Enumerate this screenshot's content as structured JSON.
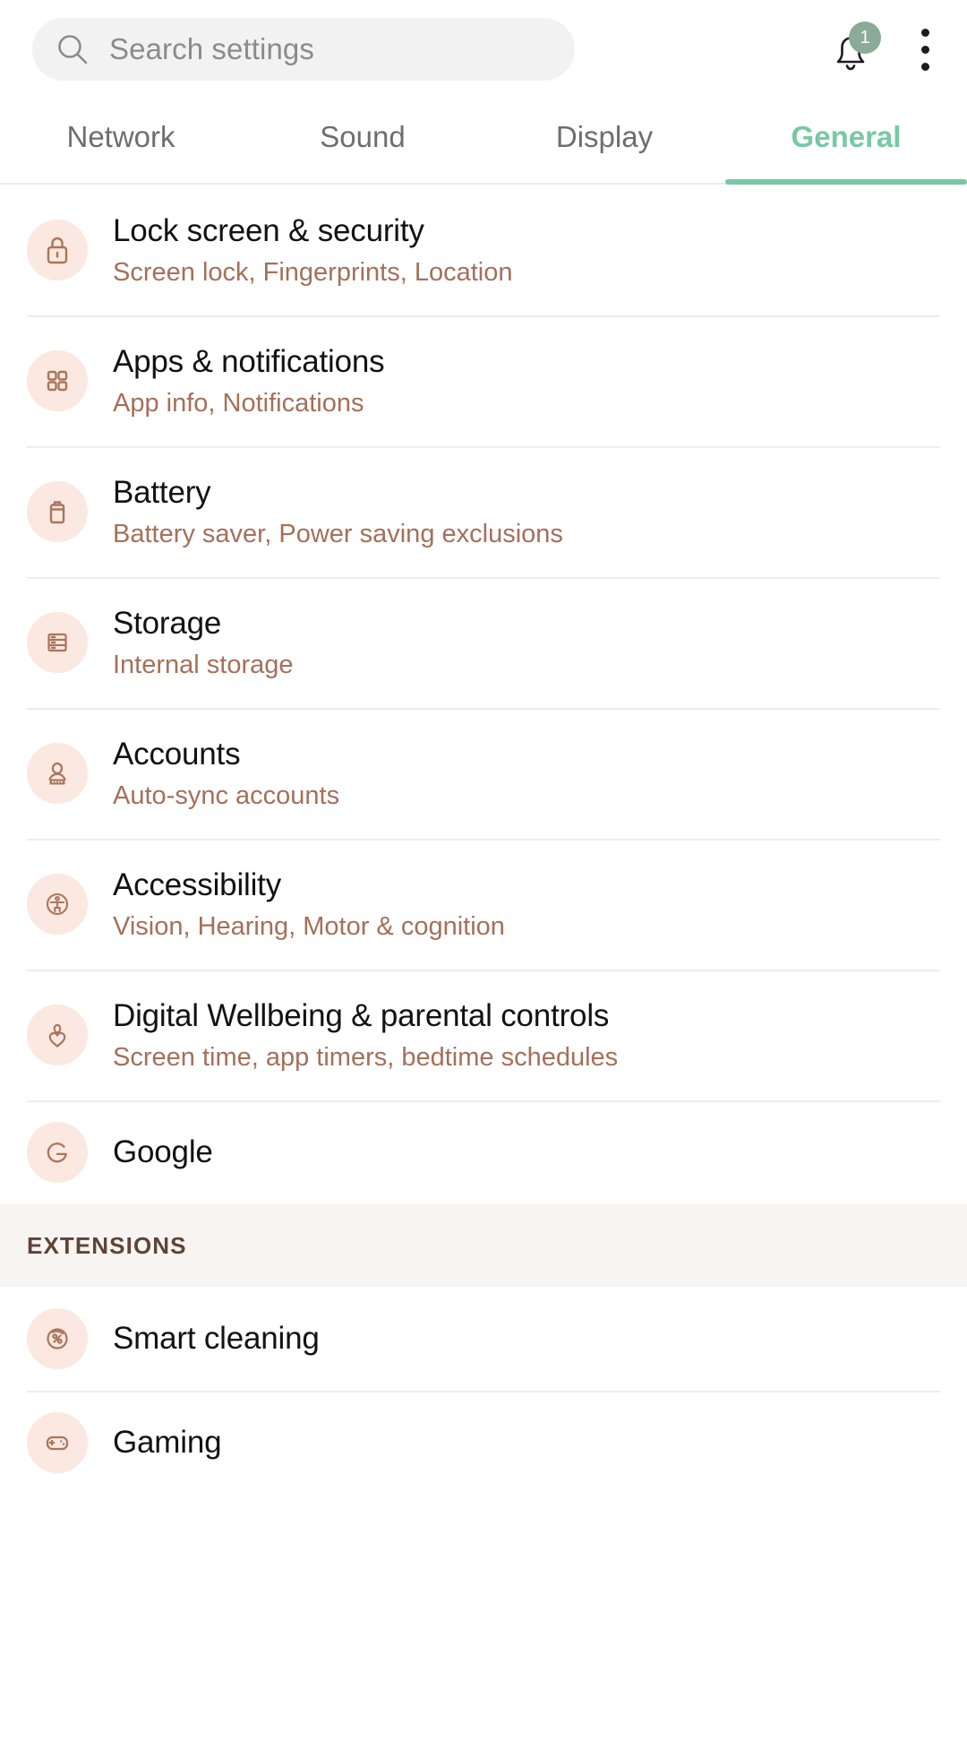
{
  "search": {
    "icon": "search-icon",
    "placeholder": "Search settings",
    "value": ""
  },
  "header": {
    "notification_icon": "bell-icon",
    "notification_count": "1",
    "overflow_icon": "kebab-menu-icon"
  },
  "tabs": [
    {
      "label": "Network",
      "active": false
    },
    {
      "label": "Sound",
      "active": false
    },
    {
      "label": "Display",
      "active": false
    },
    {
      "label": "General",
      "active": true
    }
  ],
  "colors": {
    "accent_green": "#77c9a1",
    "badge_green": "#8aab96",
    "icon_bg_peach": "#fbe8e0",
    "icon_brown": "#a9755c",
    "subtitle_brown": "#a4705a",
    "section_header_bg": "#f7f4f2",
    "section_header_text": "#5d4438",
    "search_bg": "#f3f2f2",
    "divider": "#ededed"
  },
  "main": {
    "items": [
      {
        "icon": "lock-icon",
        "title": "Lock screen & security",
        "subtitle": "Screen lock, Fingerprints, Location"
      },
      {
        "icon": "apps-grid-icon",
        "title": "Apps & notifications",
        "subtitle": "App info, Notifications"
      },
      {
        "icon": "battery-icon",
        "title": "Battery",
        "subtitle": "Battery saver, Power saving exclusions"
      },
      {
        "icon": "storage-icon",
        "title": "Storage",
        "subtitle": "Internal storage"
      },
      {
        "icon": "accounts-icon",
        "title": "Accounts",
        "subtitle": "Auto-sync accounts"
      },
      {
        "icon": "accessibility-icon",
        "title": "Accessibility",
        "subtitle": "Vision, Hearing, Motor & cognition"
      },
      {
        "icon": "digital-wellbeing-icon",
        "title": "Digital Wellbeing & parental controls",
        "subtitle": "Screen time, app timers, bedtime schedules"
      },
      {
        "icon": "google-icon",
        "title": "Google",
        "subtitle": ""
      }
    ]
  },
  "extensions": {
    "header": "EXTENSIONS",
    "items": [
      {
        "icon": "smart-cleaning-icon",
        "title": "Smart cleaning",
        "subtitle": ""
      },
      {
        "icon": "gaming-icon",
        "title": "Gaming",
        "subtitle": ""
      }
    ]
  }
}
